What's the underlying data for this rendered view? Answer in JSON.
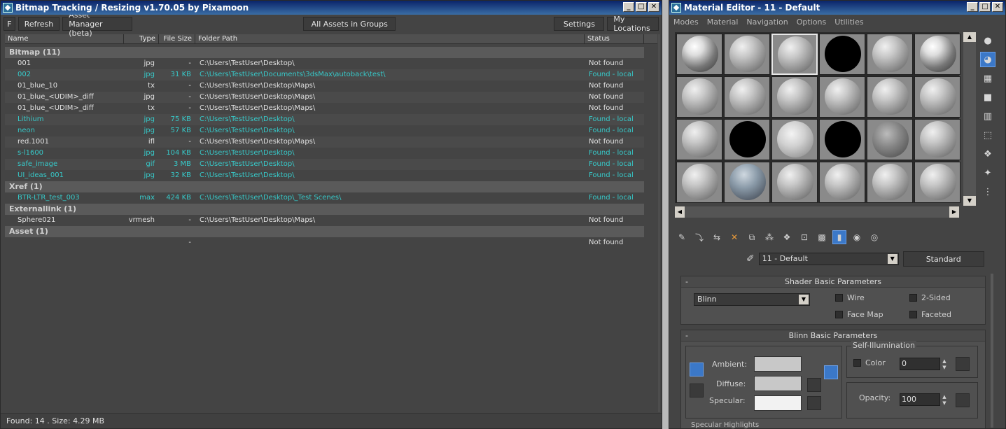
{
  "left_window": {
    "title": "Bitmap Tracking / Resizing  v1.70.05  by Pixamoon",
    "toolbar": {
      "f": "F",
      "refresh": "Refresh",
      "asset_manager": "Asset Manager (beta)",
      "all_assets": "All Assets in Groups",
      "settings": "Settings",
      "my_locations": "My Locations"
    },
    "columns": {
      "name": "Name",
      "type": "Type",
      "size": "File Size",
      "path": "Folder Path",
      "status": "Status"
    },
    "groups": [
      {
        "label": "Bitmap (11)",
        "rows": [
          {
            "name": "001",
            "type": "jpg",
            "size": "-",
            "path": "C:\\Users\\TestUser\\Desktop\\",
            "status": "Not found",
            "found": false
          },
          {
            "name": "002",
            "type": "jpg",
            "size": "31 KB",
            "path": "C:\\Users\\TestUser\\Documents\\3dsMax\\autoback\\test\\",
            "status": "Found - local",
            "found": true
          },
          {
            "name": "01_blue_10",
            "type": "tx",
            "size": "-",
            "path": "C:\\Users\\TestUser\\Desktop\\Maps\\",
            "status": "Not found",
            "found": false
          },
          {
            "name": "01_blue_<UDIM>_diff",
            "type": "jpg",
            "size": "-",
            "path": "C:\\Users\\TestUser\\Desktop\\Maps\\",
            "status": "Not found",
            "found": false
          },
          {
            "name": "01_blue_<UDIM>_diff",
            "type": "tx",
            "size": "-",
            "path": "C:\\Users\\TestUser\\Desktop\\Maps\\",
            "status": "Not found",
            "found": false
          },
          {
            "name": "Lithium",
            "type": "jpg",
            "size": "75 KB",
            "path": "C:\\Users\\TestUser\\Desktop\\",
            "status": "Found - local",
            "found": true
          },
          {
            "name": "neon",
            "type": "jpg",
            "size": "57 KB",
            "path": "C:\\Users\\TestUser\\Desktop\\",
            "status": "Found - local",
            "found": true
          },
          {
            "name": "red.1001",
            "type": "ifl",
            "size": "-",
            "path": "C:\\Users\\TestUser\\Desktop\\Maps\\",
            "status": "Not found",
            "found": false
          },
          {
            "name": "s-l1600",
            "type": "jpg",
            "size": "104 KB",
            "path": "C:\\Users\\TestUser\\Desktop\\",
            "status": "Found - local",
            "found": true
          },
          {
            "name": "safe_image",
            "type": "gif",
            "size": "3 MB",
            "path": "C:\\Users\\TestUser\\Desktop\\",
            "status": "Found - local",
            "found": true
          },
          {
            "name": "UI_ideas_001",
            "type": "jpg",
            "size": "32 KB",
            "path": "C:\\Users\\TestUser\\Desktop\\",
            "status": "Found - local",
            "found": true
          }
        ]
      },
      {
        "label": "Xref (1)",
        "rows": [
          {
            "name": "BTR-LTR_test_003",
            "type": "max",
            "size": "424 KB",
            "path": "C:\\Users\\TestUser\\Desktop\\_Test Scenes\\",
            "status": "Found - local",
            "found": true
          }
        ]
      },
      {
        "label": "Externallink (1)",
        "rows": [
          {
            "name": "Sphere021",
            "type": "vrmesh",
            "size": "-",
            "path": "C:\\Users\\TestUser\\Desktop\\Maps\\",
            "status": "Not found",
            "found": false
          }
        ]
      },
      {
        "label": "Asset (1)",
        "rows": [
          {
            "name": "",
            "type": "",
            "size": "-",
            "path": "",
            "status": "Not found",
            "found": false
          }
        ]
      }
    ],
    "status_bar": "Found: 14 . Size: 4.29 MB"
  },
  "right_window": {
    "title": "Material Editor - 11 - Default",
    "menu": [
      "Modes",
      "Material",
      "Navigation",
      "Options",
      "Utilities"
    ],
    "material_name": "11 - Default",
    "material_type": "Standard",
    "shader_panel": {
      "title": "Shader Basic Parameters",
      "shader": "Blinn",
      "wire": "Wire",
      "two_sided": "2-Sided",
      "face_map": "Face Map",
      "faceted": "Faceted"
    },
    "blinn_panel": {
      "title": "Blinn Basic Parameters",
      "ambient": "Ambient:",
      "diffuse": "Diffuse:",
      "specular": "Specular:",
      "self_illum": "Self-Illumination",
      "color": "Color",
      "color_value": "0",
      "opacity": "Opacity:",
      "opacity_value": "100",
      "next_section": "Specular Highlights"
    }
  }
}
